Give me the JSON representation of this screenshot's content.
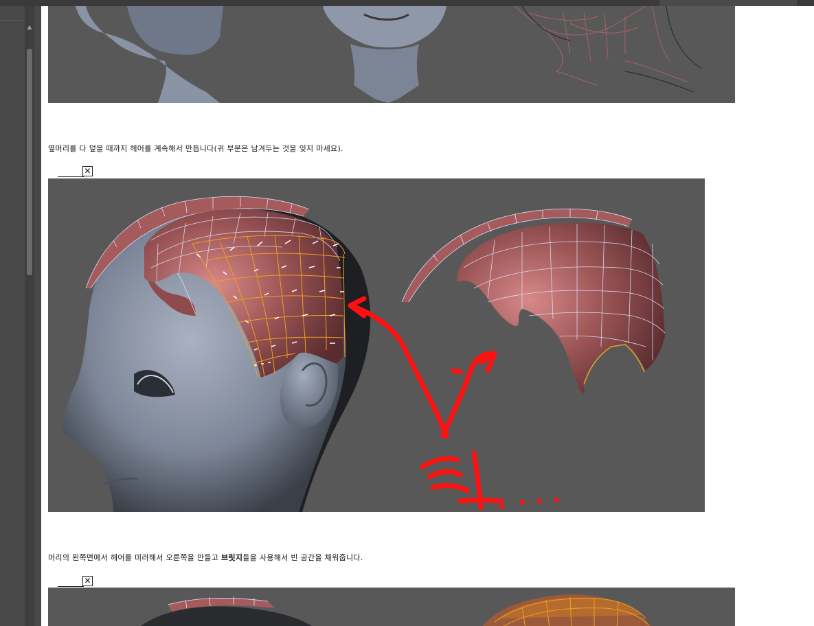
{
  "captions": {
    "first": "옆머리를 다 덮을 때까지 헤어를 계속해서 만듭니다(귀 부분은 남겨두는 것을 잊지 마세요).",
    "second_before": "머리의 왼쪽면에서 헤어를 미러해서 오른쪽을 만들고 ",
    "second_bold": "브릿지",
    "second_after": "들을 사용해서 빈 공간을 채워줍니다."
  },
  "broken_image_glyph": "✕",
  "annotation": {
    "handwritten_text": "헐....",
    "color": "#ff1010"
  },
  "colors": {
    "viewport_bg": "#585858",
    "hair_mesh": "#9c5556",
    "selected_edges": "#f0a020",
    "wire": "#dfe6ff",
    "head": "#8a93a3"
  }
}
